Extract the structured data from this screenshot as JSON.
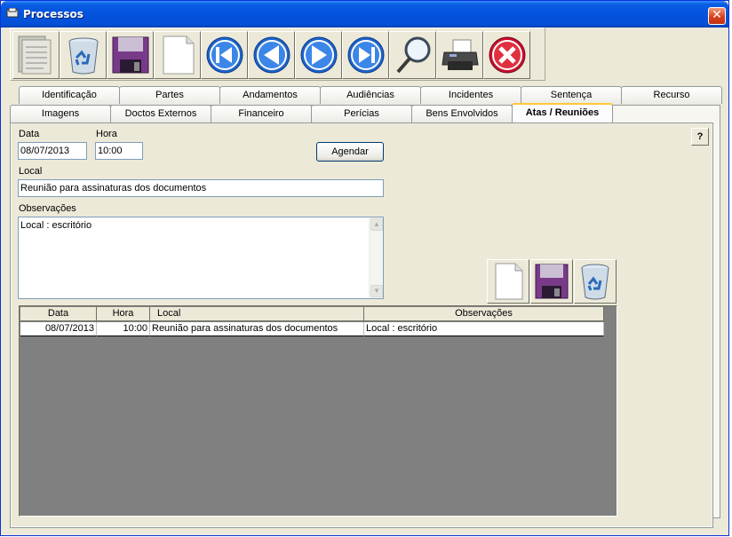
{
  "window": {
    "title": "Processos"
  },
  "toolbar": {
    "buttons": [
      {
        "name": "new-process-button",
        "icon": "document-list-icon"
      },
      {
        "name": "delete-button",
        "icon": "recycle-bin-icon"
      },
      {
        "name": "save-button",
        "icon": "floppy-disk-icon"
      },
      {
        "name": "new-button",
        "icon": "blank-page-icon"
      },
      {
        "name": "first-record-button",
        "icon": "first-record-icon"
      },
      {
        "name": "previous-record-button",
        "icon": "previous-icon"
      },
      {
        "name": "next-record-button",
        "icon": "next-icon"
      },
      {
        "name": "last-record-button",
        "icon": "last-record-icon"
      },
      {
        "name": "search-button",
        "icon": "magnifier-icon"
      },
      {
        "name": "print-button",
        "icon": "printer-icon"
      },
      {
        "name": "exit-button",
        "icon": "red-x-icon"
      }
    ]
  },
  "tabs": {
    "row1": [
      "Identificação",
      "Partes",
      "Andamentos",
      "Audiências",
      "Incidentes",
      "Sentença",
      "Recurso"
    ],
    "row2": [
      "Imagens",
      "Doctos Externos",
      "Financeiro",
      "Perícias",
      "Bens Envolvidos",
      "Atas / Reuniões"
    ],
    "active": "Atas / Reuniões"
  },
  "form": {
    "data_label": "Data",
    "data_value": "08/07/2013",
    "hora_label": "Hora",
    "hora_value": "10:00",
    "agendar_label": "Agendar",
    "help_label": "?",
    "local_label": "Local",
    "local_value": "Reunião para assinaturas dos documentos",
    "obs_label": "Observações",
    "obs_value": "Local : escritório"
  },
  "grid": {
    "columns": [
      "Data",
      "Hora",
      "Local",
      "Observações"
    ],
    "rows": [
      {
        "data": "08/07/2013",
        "hora": "10:00",
        "local": "Reunião para assinaturas dos documentos",
        "obs": "Local : escritório"
      }
    ]
  },
  "colors": {
    "title_bar": "#0454df",
    "panel": "#ece9d8",
    "grid_bg": "#808080",
    "active_tab_accent": "#ffc83c"
  }
}
